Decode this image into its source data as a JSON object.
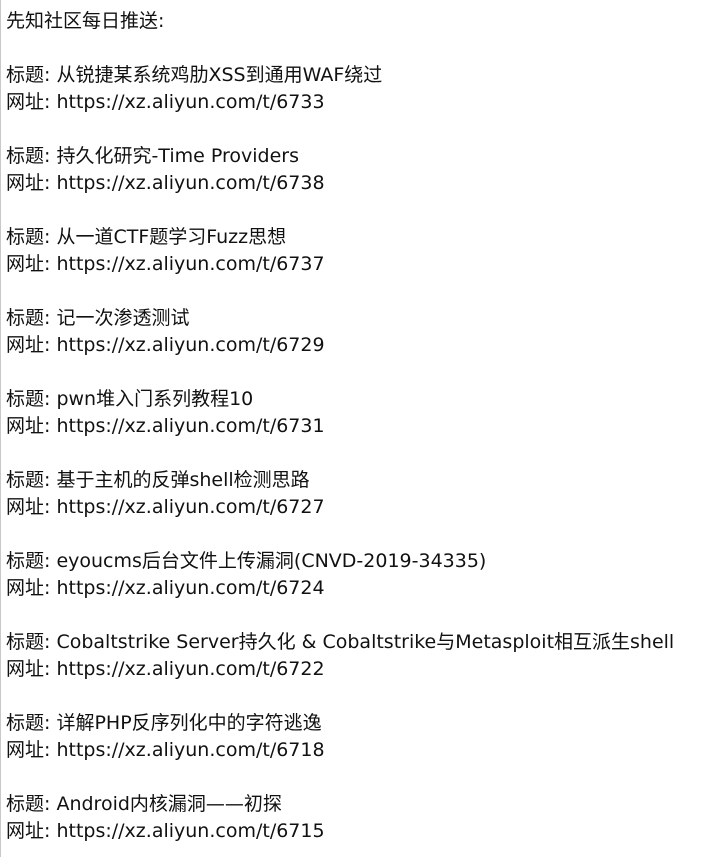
{
  "header": "先知社区每日推送:",
  "title_label": "标题:",
  "url_label": "网址:",
  "entries": [
    {
      "title": "从锐捷某系统鸡肋XSS到通用WAF绕过",
      "url": "https://xz.aliyun.com/t/6733"
    },
    {
      "title": "持久化研究-Time Providers",
      "url": "https://xz.aliyun.com/t/6738"
    },
    {
      "title": "从一道CTF题学习Fuzz思想",
      "url": "https://xz.aliyun.com/t/6737"
    },
    {
      "title": "记一次渗透测试",
      "url": "https://xz.aliyun.com/t/6729"
    },
    {
      "title": "pwn堆入门系列教程10",
      "url": "https://xz.aliyun.com/t/6731"
    },
    {
      "title": "基于主机的反弹shell检测思路",
      "url": "https://xz.aliyun.com/t/6727"
    },
    {
      "title": "eyoucms后台文件上传漏洞(CNVD-2019-34335)",
      "url": "https://xz.aliyun.com/t/6724"
    },
    {
      "title": "Cobaltstrike Server持久化 & Cobaltstrike与Metasploit相互派生shell",
      "url": "https://xz.aliyun.com/t/6722"
    },
    {
      "title": "详解PHP反序列化中的字符逃逸",
      "url": "https://xz.aliyun.com/t/6718"
    },
    {
      "title": "Android内核漏洞——初探",
      "url": "https://xz.aliyun.com/t/6715"
    }
  ]
}
